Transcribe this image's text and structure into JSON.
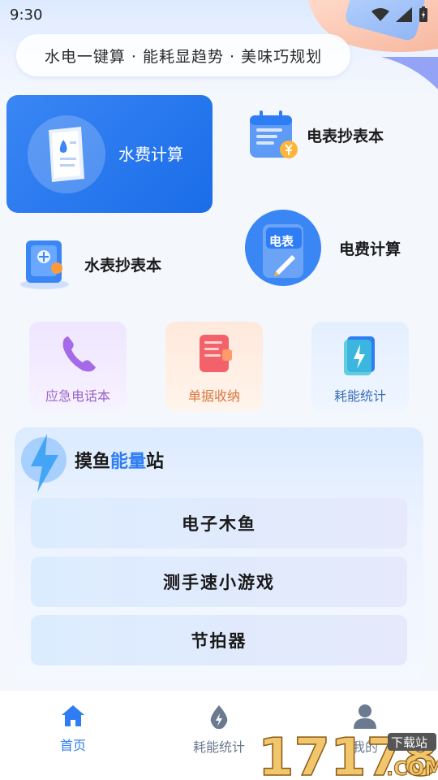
{
  "status": {
    "time": "9:30"
  },
  "slogan": "水电一键算 · 能耗显趋势 · 美味巧规划",
  "features": {
    "water_fee": "水费计算",
    "electric_meter": "电表抄表本",
    "water_meter": "水表抄表本",
    "electric_fee": "电费计算",
    "electric_badge": "电表"
  },
  "tools": [
    {
      "label": "应急电话本",
      "color": "#9a64c8"
    },
    {
      "label": "单据收纳",
      "color": "#d9773f"
    },
    {
      "label": "耗能统计",
      "color": "#3b6fb8"
    }
  ],
  "panel": {
    "title_a": "摸鱼",
    "title_b": "能量",
    "title_c": "站",
    "items": [
      "电子木鱼",
      "测手速小游戏",
      "节拍器"
    ]
  },
  "tabs": [
    {
      "label": "首页",
      "active": true
    },
    {
      "label": "耗能统计",
      "active": false
    },
    {
      "label": "我的",
      "active": false
    }
  ],
  "colors": {
    "accent": "#2f7df4",
    "tab_active": "#2f7df4",
    "tab_inactive": "#6b7a90"
  },
  "watermark": {
    "number": "17178",
    "tag": "下载站",
    "domain": ".COM"
  }
}
